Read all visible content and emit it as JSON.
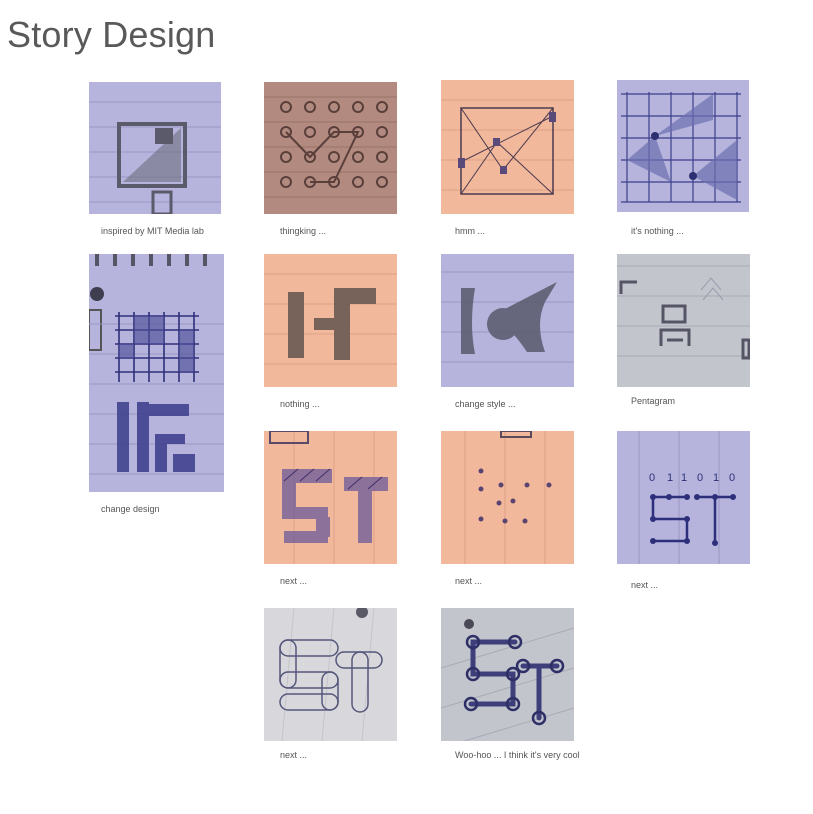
{
  "page": {
    "title": "Story Design"
  },
  "gallery": [
    {
      "caption": "inspired by MIT Media lab",
      "tint": "#b6b4dc",
      "icon": "sketch-square-diagonal-icon"
    },
    {
      "caption": "thingking ...",
      "tint": "#b28a80",
      "icon": "sketch-dot-grid-icon"
    },
    {
      "caption": "hmm ...",
      "tint": "#f2b89b",
      "icon": "sketch-square-star-icon"
    },
    {
      "caption": "it's nothing ...",
      "tint": "#b6b4dc",
      "icon": "sketch-grid-triangles-icon"
    },
    {
      "caption": "change design",
      "tint": "#b6b4dc",
      "icon": "sketch-notebook-grid-icon"
    },
    {
      "caption": "nothing ...",
      "tint": "#f2b89b",
      "icon": "sketch-block-letters-icon"
    },
    {
      "caption": "change style ...",
      "tint": "#b6b4dc",
      "icon": "sketch-bracket-circle-icon"
    },
    {
      "caption": "Pentagram",
      "tint": "#c3c5cc",
      "icon": "sketch-small-glyphs-icon"
    },
    {
      "caption": "next ...",
      "tint": "#f2b89b",
      "icon": "sketch-hatched-st-icon"
    },
    {
      "caption": "next ...",
      "tint": "#f2b89b",
      "icon": "sketch-dots-icon"
    },
    {
      "caption": "next ...",
      "tint": "#b6b4dc",
      "icon": "sketch-binary-st-icon"
    },
    {
      "caption": "next ...",
      "tint": "#d8d8dc",
      "icon": "sketch-outline-st-icon"
    },
    {
      "caption": "Woo-hoo ... I think it's very cool",
      "tint": "#c3c5cc",
      "icon": "sketch-final-st-icon"
    }
  ]
}
